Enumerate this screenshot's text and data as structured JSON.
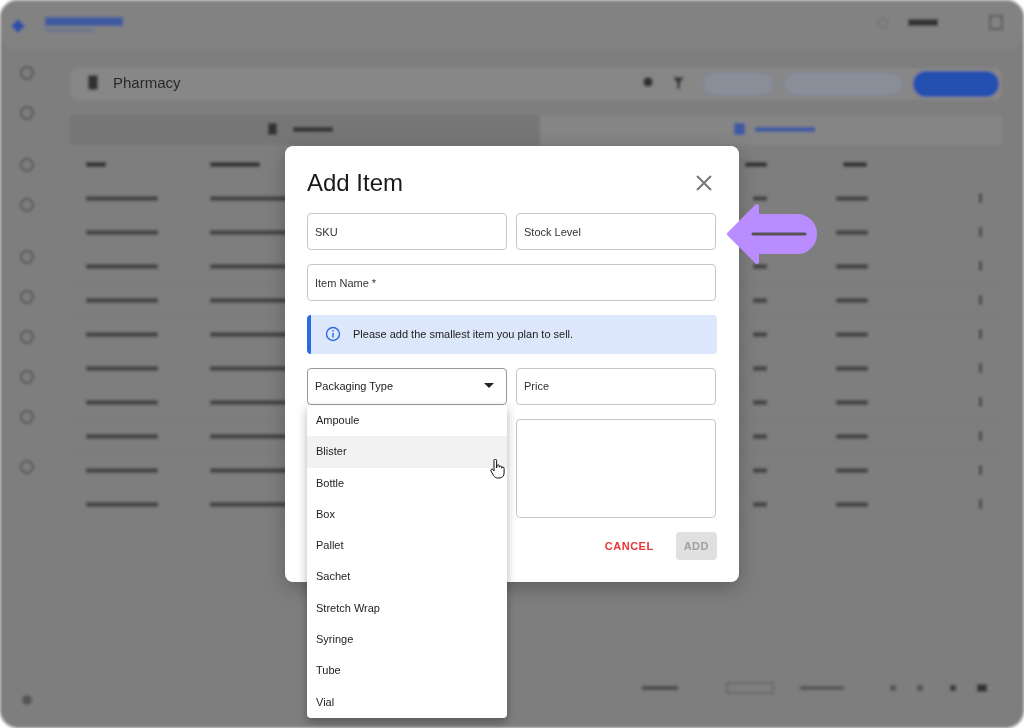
{
  "page": {
    "title": "Pharmacy"
  },
  "dialog": {
    "title": "Add Item",
    "fields": [
      {
        "placeholder": "SKU"
      },
      {
        "placeholder": "Stock Level"
      },
      {
        "placeholder": "Item Name *"
      }
    ],
    "info": "Please add the smallest item you plan to sell.",
    "packaging": {
      "placeholder": "Packaging Type",
      "expanded": true
    },
    "price": {
      "placeholder": "Price"
    },
    "buttons": [
      {
        "label": "CANCEL",
        "kind": "text",
        "disabled": false
      },
      {
        "label": "ADD",
        "kind": "filled",
        "disabled": true
      }
    ]
  },
  "menu": [
    {
      "label": "Ampoule",
      "highlighted": false
    },
    {
      "label": "Blister",
      "highlighted": true
    },
    {
      "label": "Bottle",
      "highlighted": false
    },
    {
      "label": "Box",
      "highlighted": false
    },
    {
      "label": "Pallet",
      "highlighted": false
    },
    {
      "label": "Sachet",
      "highlighted": false
    },
    {
      "label": "Stretch Wrap",
      "highlighted": false
    },
    {
      "label": "Syringe",
      "highlighted": false
    },
    {
      "label": "Tube",
      "highlighted": false
    },
    {
      "label": "Vial",
      "highlighted": false
    }
  ]
}
